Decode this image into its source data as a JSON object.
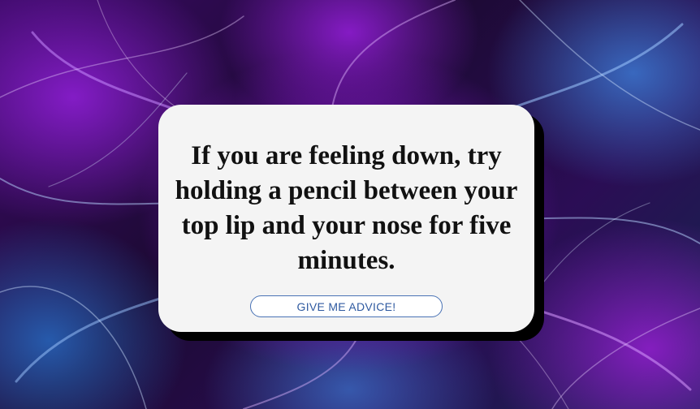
{
  "advice": {
    "text": "If you are feeling down, try holding a pencil between your top lip and your nose for five minutes."
  },
  "button": {
    "label": "GIVE ME ADVICE!"
  },
  "colors": {
    "card_background": "#f4f4f4",
    "card_shadow": "#000000",
    "button_border": "#4a73b5",
    "button_text": "#2f5aa0",
    "background_purple": "#8a1fd0",
    "background_blue": "#3a7ad0"
  }
}
